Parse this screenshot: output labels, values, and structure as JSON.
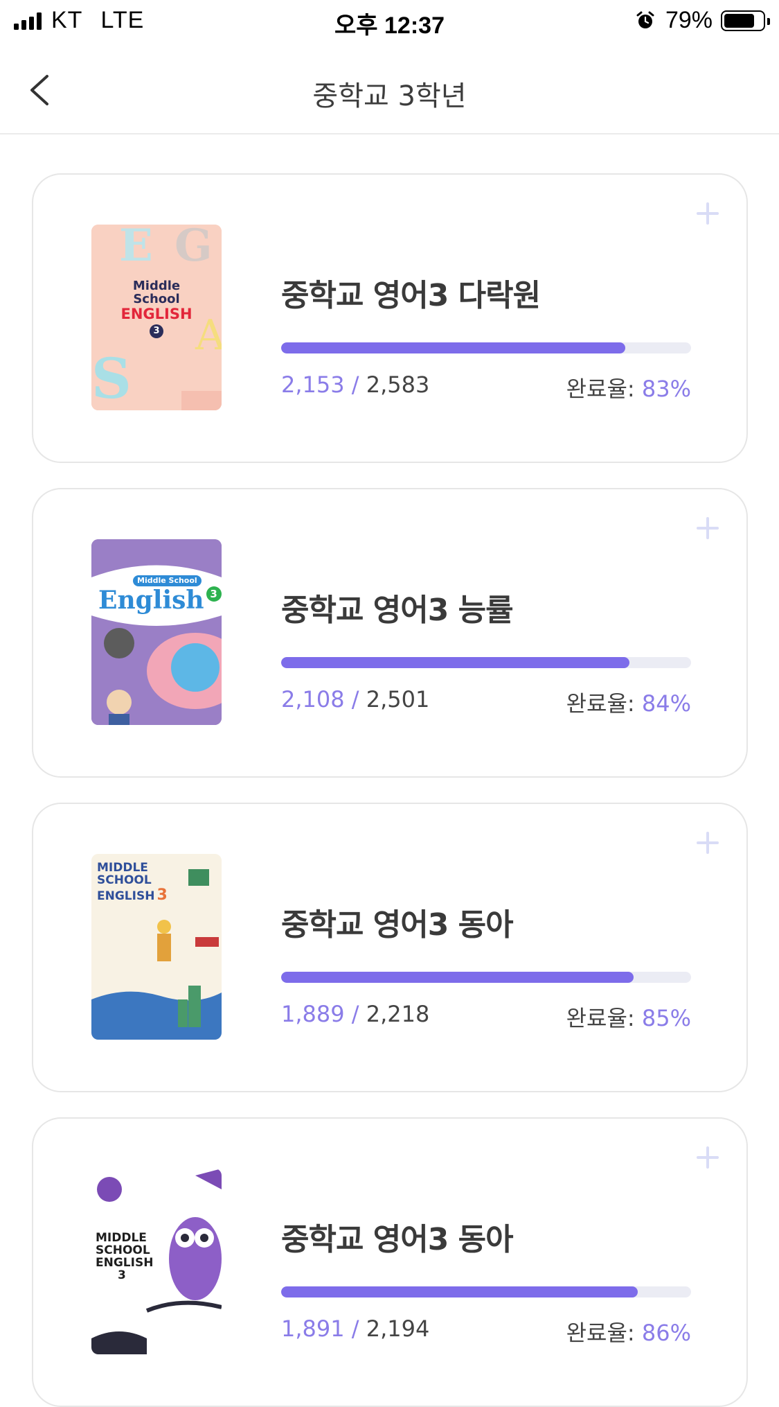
{
  "status": {
    "carrier": "KT",
    "network": "LTE",
    "time": "오후 12:37",
    "battery": "79%",
    "battery_level": 0.79
  },
  "nav": {
    "title": "중학교 3학년"
  },
  "books": [
    {
      "title": "중학교 영어3 다락원",
      "done": "2,153",
      "total": "2,583",
      "rate_label": "완료율:",
      "rate": "83%",
      "progress": 0.84,
      "cover": {
        "line1": "Middle",
        "line2": "School",
        "line3": "ENGLISH",
        "num": "3",
        "bg": "#f7c6b8",
        "accent": "#e2263a"
      }
    },
    {
      "title": "중학교 영어3 능률",
      "done": "2,108",
      "total": "2,501",
      "rate_label": "완료율:",
      "rate": "84%",
      "progress": 0.85,
      "cover": {
        "line1": "Middle School",
        "line2": "English",
        "num": "3",
        "bg": "#9b80c8",
        "accent": "#2e8bd6"
      }
    },
    {
      "title": "중학교 영어3 동아",
      "done": "1,889",
      "total": "2,218",
      "rate_label": "완료율:",
      "rate": "85%",
      "progress": 0.86,
      "cover": {
        "line1": "MIDDLE",
        "line2": "SCHOOL",
        "line3": "ENGLISH",
        "num": "3",
        "bg": "#f8f2e4",
        "accent": "#2f4f9a"
      }
    },
    {
      "title": "중학교 영어3 동아",
      "done": "1,891",
      "total": "2,194",
      "rate_label": "완료율:",
      "rate": "86%",
      "progress": 0.87,
      "cover": {
        "line1": "MIDDLE",
        "line2": "SCHOOL",
        "line3": "ENGLISH",
        "num": "3",
        "bg": "#ffffff",
        "accent": "#7b4bb5"
      }
    }
  ]
}
